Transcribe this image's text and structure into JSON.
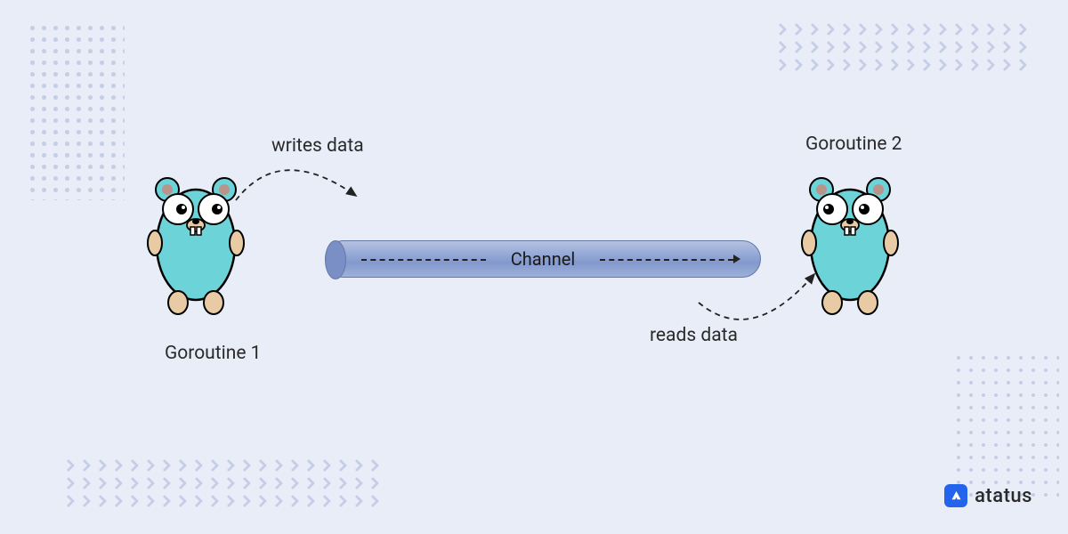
{
  "diagram": {
    "goroutine1_label": "Goroutine 1",
    "goroutine2_label": "Goroutine 2",
    "writes_label": "writes data",
    "reads_label": "reads data",
    "channel_label": "Channel"
  },
  "branding": {
    "name": "atatus"
  },
  "colors": {
    "background": "#e8edf8",
    "channel_fill": "#93a7d6",
    "gopher_body": "#6cd3d9",
    "brand": "#2463eb"
  }
}
